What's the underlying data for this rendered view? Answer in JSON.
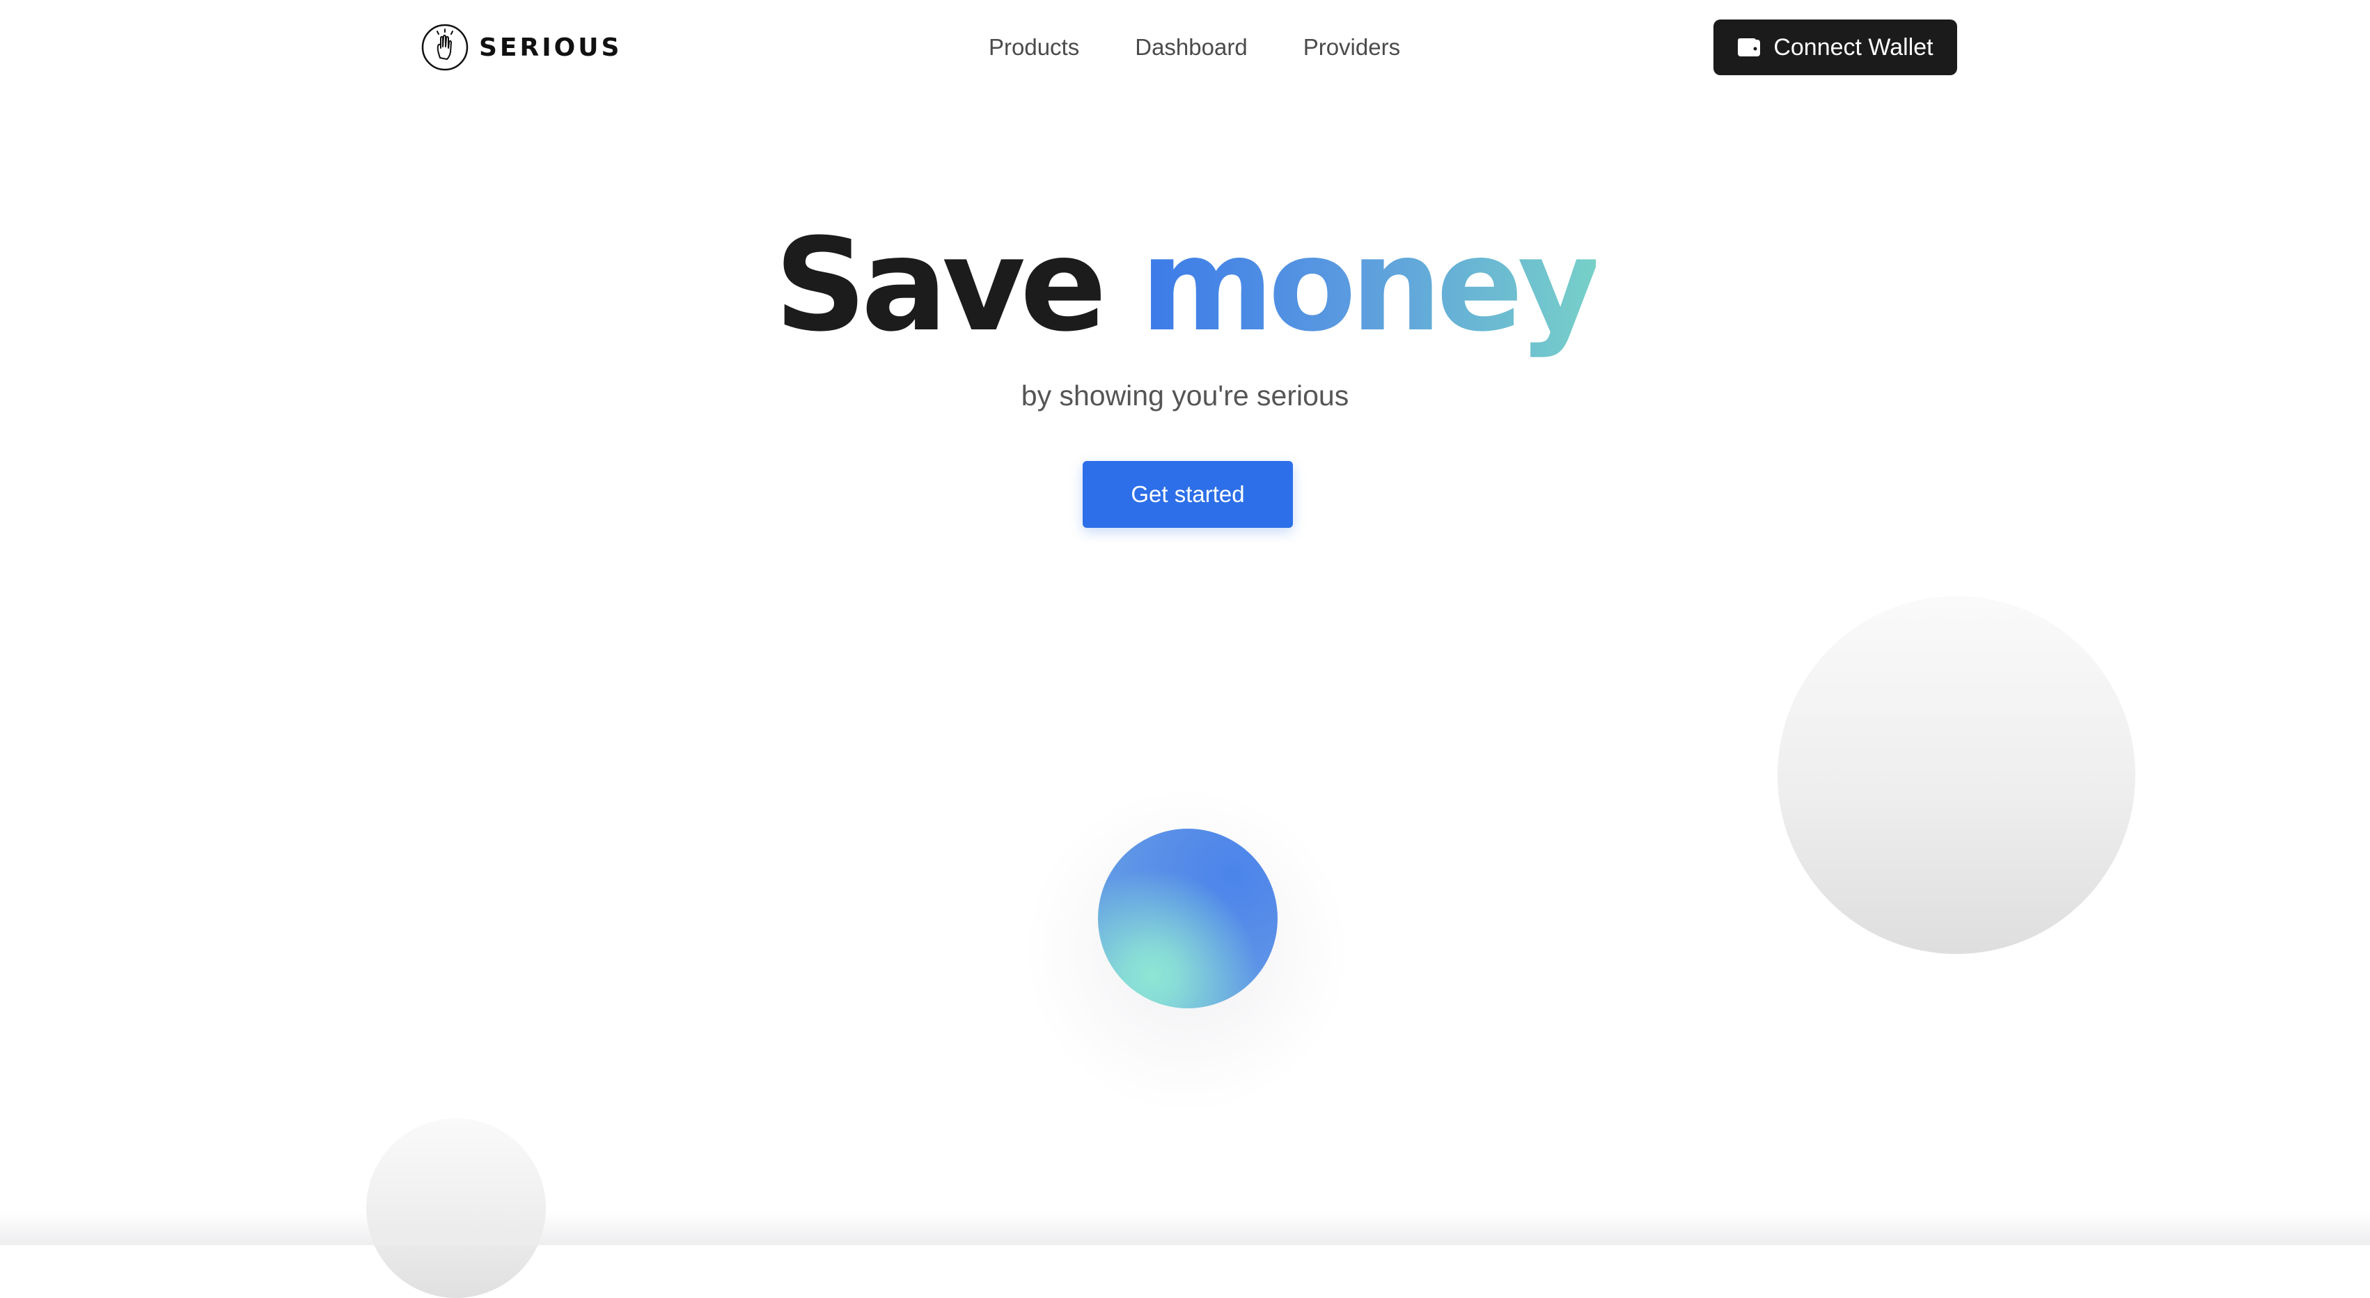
{
  "nav": {
    "logo_text": "SERIOUS",
    "logo_icon": "hand-circle-icon",
    "links": [
      {
        "label": "Products"
      },
      {
        "label": "Dashboard"
      },
      {
        "label": "Providers"
      }
    ],
    "connect_wallet": {
      "label": "Connect Wallet",
      "icon": "wallet-icon"
    }
  },
  "hero": {
    "title_plain": "Save",
    "title_accent": "money",
    "subtitle": "by showing you're serious",
    "cta_label": "Get started"
  },
  "colors": {
    "cta": "#2d6fe8",
    "wallet_button": "#1b1b1b",
    "accent_gradient_start": "#3b7ae8",
    "accent_gradient_end": "#77d0c8",
    "orb_blue": "#4b84ea",
    "orb_teal": "#8ee6d4"
  }
}
